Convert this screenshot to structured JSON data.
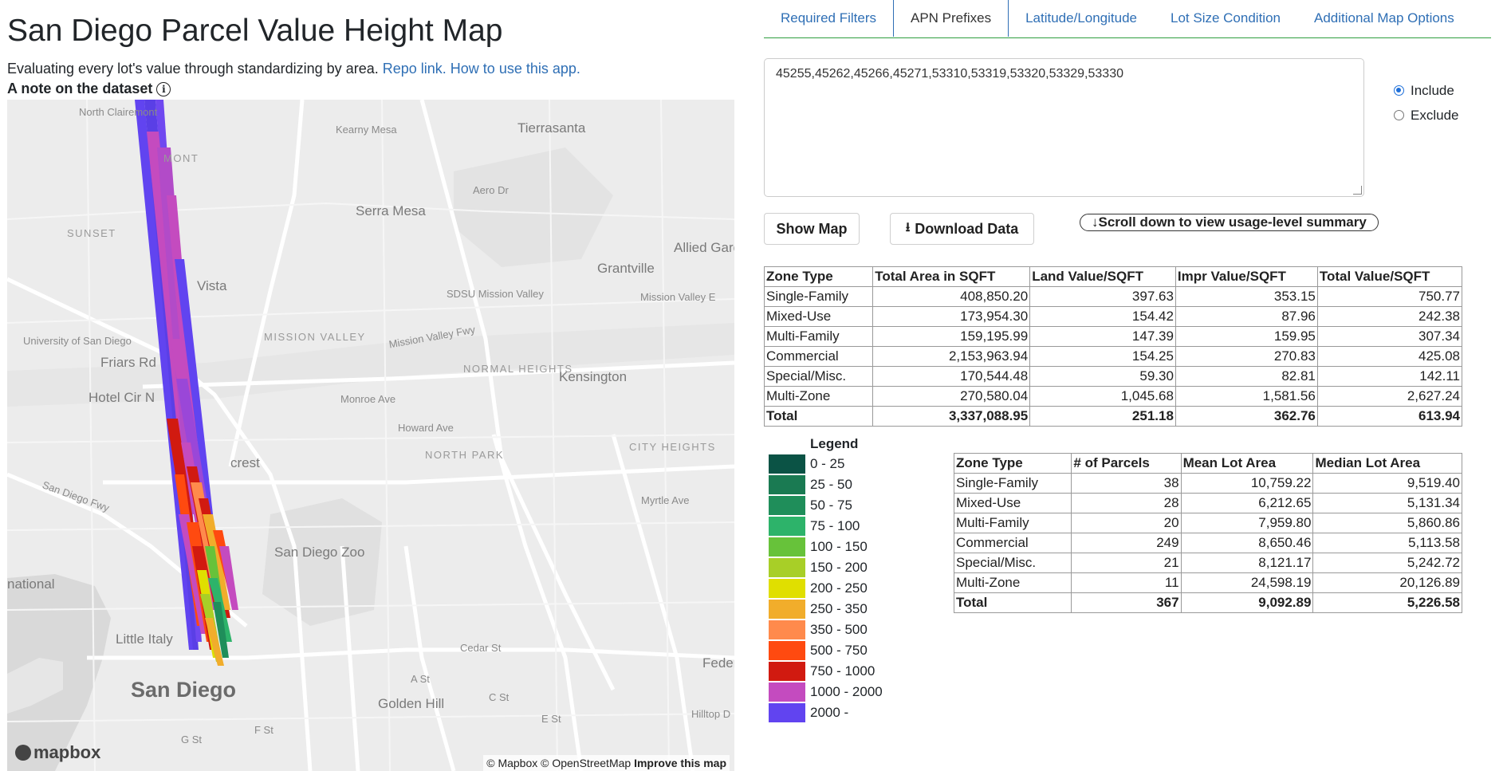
{
  "header": {
    "title": "San Diego Parcel Value Height Map",
    "subtitle_text": "Evaluating every lot's value through standardizing by area.",
    "repo_link": "Repo link.",
    "howto_link": "How to use this app.",
    "note": "A note on the dataset",
    "info_icon": "i"
  },
  "map": {
    "labels": {
      "north_clairemont": "North Clairemont",
      "kearny_mesa": "Kearny Mesa",
      "tierrasanta": "Tierrasanta",
      "serra_mesa": "Serra Mesa",
      "allied_gardens": "Allied Garde",
      "grantville": "Grantville",
      "sdsu_mission_valley": "SDSU Mission Valley",
      "mission_valley_fwy": "Mission Valley Fwy",
      "mission_valley": "MISSION VALLEY",
      "normal_heights": "NORMAL HEIGHTS",
      "kensington": "Kensington",
      "city_heights": "CITY HEIGHTS",
      "north_park": "NORTH PARK",
      "university_of_san_diego": "University of San Diego",
      "friars_rd": "Friars Rd",
      "hotel_cir": "Hotel Cir N",
      "san_diego_fwy": "San Diego Fwy",
      "national": "national",
      "little_italy": "Little Italy",
      "san_diego": "San Diego",
      "golden_hill": "Golden Hill",
      "san_diego_zoo": "San Diego Zoo",
      "monroe_ave": "Monroe Ave",
      "howard_ave": "Howard Ave",
      "myrtle_ave": "Myrtle Ave",
      "cedar_st": "Cedar St",
      "a_st": "A St",
      "c_st": "C St",
      "e_st": "E St",
      "f_st": "F St",
      "g_st": "G St",
      "hilltop": "Hilltop D",
      "feder": "Feder",
      "sunset": "SUNSET",
      "mont": "MONT",
      "vista": "Vista",
      "crest": "crest",
      "mission_valley_east": "Mission Valley E",
      "aero_dr": "Aero Dr"
    },
    "logo": "mapbox",
    "attribution": "© Mapbox © OpenStreetMap",
    "improve": "Improve this map"
  },
  "tabs": [
    {
      "label": "Required Filters",
      "active": false
    },
    {
      "label": "APN Prefixes",
      "active": true
    },
    {
      "label": "Latitude/Longitude",
      "active": false
    },
    {
      "label": "Lot Size Condition",
      "active": false
    },
    {
      "label": "Additional Map Options",
      "active": false
    }
  ],
  "apn": {
    "value": "45255,45262,45266,45271,53310,53319,53320,53329,53330",
    "include_label": "Include",
    "exclude_label": "Exclude",
    "selected": "Include"
  },
  "buttons": {
    "show_map": "Show Map",
    "download": "Download Data",
    "download_icon": "⭳",
    "scroll": "↓Scroll down to view usage-level summary"
  },
  "value_table": {
    "headers": [
      "Zone Type",
      "Total Area in SQFT",
      "Land Value/SQFT",
      "Impr Value/SQFT",
      "Total Value/SQFT"
    ],
    "rows": [
      [
        "Single-Family",
        "408,850.20",
        "397.63",
        "353.15",
        "750.77"
      ],
      [
        "Mixed-Use",
        "173,954.30",
        "154.42",
        "87.96",
        "242.38"
      ],
      [
        "Multi-Family",
        "159,195.99",
        "147.39",
        "159.95",
        "307.34"
      ],
      [
        "Commercial",
        "2,153,963.94",
        "154.25",
        "270.83",
        "425.08"
      ],
      [
        "Special/Misc.",
        "170,544.48",
        "59.30",
        "82.81",
        "142.11"
      ],
      [
        "Multi-Zone",
        "270,580.04",
        "1,045.68",
        "1,581.56",
        "2,627.24"
      ]
    ],
    "total": [
      "Total",
      "3,337,088.95",
      "251.18",
      "362.76",
      "613.94"
    ]
  },
  "lot_table": {
    "headers": [
      "Zone Type",
      "# of Parcels",
      "Mean Lot Area",
      "Median Lot Area"
    ],
    "rows": [
      [
        "Single-Family",
        "38",
        "10,759.22",
        "9,519.40"
      ],
      [
        "Mixed-Use",
        "28",
        "6,212.65",
        "5,131.34"
      ],
      [
        "Multi-Family",
        "20",
        "7,959.80",
        "5,860.86"
      ],
      [
        "Commercial",
        "249",
        "8,650.46",
        "5,113.58"
      ],
      [
        "Special/Misc.",
        "21",
        "8,121.17",
        "5,242.72"
      ],
      [
        "Multi-Zone",
        "11",
        "24,598.19",
        "20,126.89"
      ]
    ],
    "total": [
      "Total",
      "367",
      "9,092.89",
      "5,226.58"
    ]
  },
  "legend": {
    "title": "Legend",
    "items": [
      {
        "label": "0 - 25",
        "color": "#0b5345"
      },
      {
        "label": "25 - 50",
        "color": "#1a7a52"
      },
      {
        "label": "50 - 75",
        "color": "#1f8e5a"
      },
      {
        "label": "75 - 100",
        "color": "#2db36a"
      },
      {
        "label": "100 - 150",
        "color": "#67c23a"
      },
      {
        "label": "150 - 200",
        "color": "#a8cf27"
      },
      {
        "label": "200 - 250",
        "color": "#e0df00"
      },
      {
        "label": "250 - 350",
        "color": "#f1ad2b"
      },
      {
        "label": "350 - 500",
        "color": "#ff8a4c"
      },
      {
        "label": "500 - 750",
        "color": "#ff4a10"
      },
      {
        "label": "750 - 1000",
        "color": "#d11a10"
      },
      {
        "label": "1000 - 2000",
        "color": "#c44bbf"
      },
      {
        "label": "2000 -",
        "color": "#6144f0"
      }
    ]
  }
}
